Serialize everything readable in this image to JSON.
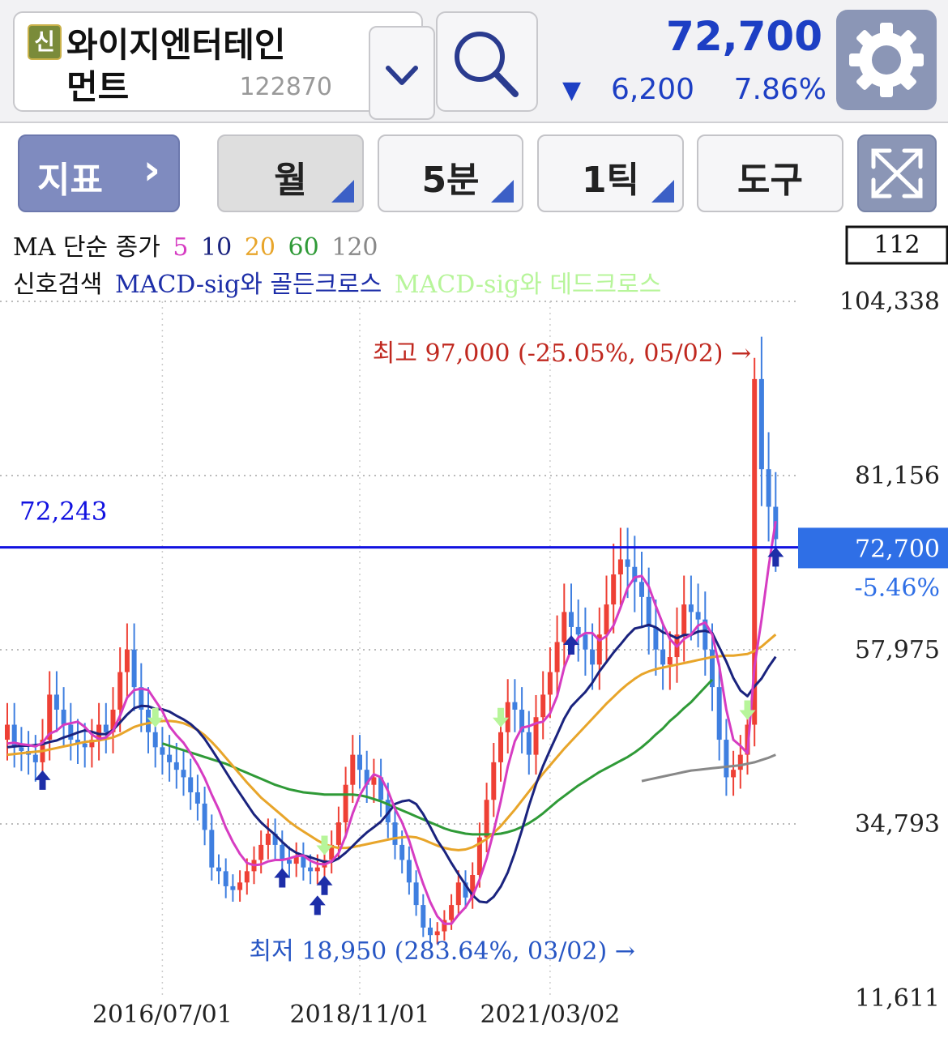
{
  "header": {
    "badge": "신",
    "name_line1": "와이지엔터테인",
    "name_line2": "먼트",
    "code": "122870",
    "price": "72,700",
    "change_arrow": "▼",
    "change_amount": "6,200",
    "change_percent": "7.86%",
    "icons": {
      "dropdown": "chevron-down-icon",
      "search": "search-icon",
      "settings": "gear-icon"
    }
  },
  "toolbar": {
    "indicator": "지표",
    "indicator_arrow": "›",
    "period": "월",
    "minute": "5분",
    "tick": "1틱",
    "tools": "도구",
    "expand_icon": "expand-icon"
  },
  "legend": {
    "ma_prefix": "MA 단순 종가",
    "ma_periods": [
      {
        "label": "5",
        "color": "#d63cc2"
      },
      {
        "label": "10",
        "color": "#1a237e"
      },
      {
        "label": "20",
        "color": "#e8a52a"
      },
      {
        "label": "60",
        "color": "#2f9a37"
      },
      {
        "label": "120",
        "color": "#888888"
      }
    ],
    "signal_prefix": "신호검색",
    "signal_golden": "MACD-sig와 골든크로스",
    "signal_dead": "MACD-sig와 데드크로스",
    "golden_color": "#1d2ea8",
    "dead_color": "#b7f59a"
  },
  "colors": {
    "up": "#ee4035",
    "down": "#3f7fe0",
    "price_line": "#1212e0",
    "current_tag": "#2f6fe6"
  },
  "chart_data": {
    "type": "candlestick",
    "y_ticks": [
      "104,338",
      "81,156",
      "57,975",
      "34,793",
      "11,611"
    ],
    "y_tick_values": [
      104338,
      81156,
      57975,
      34793,
      11611
    ],
    "x_ticks": [
      "2016/07/01",
      "2018/11/01",
      "2021/03/02"
    ],
    "x_tick_index": [
      22,
      50,
      77
    ],
    "count_label": "112",
    "reference_line": {
      "label": "72,243",
      "value": 72243
    },
    "current": {
      "label": "72,700",
      "value": 72700,
      "diff": "-5.46%"
    },
    "high_annotation": {
      "text": "최고 97,000 (-25.05%, 05/02) →",
      "value": 97000,
      "index": 106
    },
    "low_annotation": {
      "text": "최저 18,950 (283.64%, 03/02) →",
      "value": 18950,
      "index": 61
    },
    "close": [
      48000,
      45000,
      44500,
      44000,
      43000,
      46000,
      52000,
      50000,
      48000,
      46000,
      45500,
      45000,
      46000,
      48000,
      47000,
      50000,
      55000,
      58000,
      53000,
      50000,
      47000,
      45000,
      44000,
      43000,
      42000,
      41000,
      39000,
      37500,
      34000,
      29000,
      28500,
      26500,
      26000,
      27000,
      28500,
      30000,
      32000,
      33500,
      32000,
      30000,
      29500,
      30500,
      29000,
      28500,
      29000,
      30000,
      32000,
      35000,
      40000,
      44000,
      42000,
      40000,
      41000,
      38000,
      35000,
      32000,
      30000,
      27000,
      24000,
      21000,
      20000,
      20500,
      22000,
      24000,
      27000,
      25000,
      28000,
      33000,
      38000,
      43000,
      47000,
      51000,
      50000,
      47000,
      44000,
      49000,
      52000,
      55000,
      59000,
      63000,
      61000,
      60000,
      58000,
      56000,
      60000,
      64000,
      68000,
      70000,
      69000,
      67000,
      65000,
      61000,
      58000,
      56000,
      57000,
      60000,
      64000,
      63000,
      62000,
      58000,
      53000,
      46000,
      41000,
      42000,
      44000,
      48000,
      94000,
      82000,
      77000,
      72700
    ],
    "open": [
      46000,
      48000,
      45000,
      44500,
      44000,
      43000,
      46000,
      52000,
      50000,
      48000,
      46000,
      45500,
      45000,
      46000,
      48000,
      47000,
      50000,
      55000,
      58000,
      53000,
      50000,
      47000,
      45000,
      44000,
      43000,
      42000,
      41000,
      39000,
      37500,
      34000,
      29000,
      28500,
      26500,
      26000,
      27000,
      28500,
      30000,
      32000,
      33500,
      32000,
      30000,
      29500,
      30500,
      29000,
      28500,
      29000,
      30000,
      32000,
      35000,
      40000,
      44000,
      42000,
      40000,
      41000,
      38000,
      35000,
      32000,
      30000,
      27000,
      24000,
      21000,
      20000,
      20500,
      22000,
      24000,
      27000,
      25000,
      28000,
      33000,
      38000,
      43000,
      47000,
      51000,
      50000,
      47000,
      44000,
      49000,
      52000,
      55000,
      59000,
      63000,
      61000,
      60000,
      58000,
      56000,
      60000,
      64000,
      68000,
      70000,
      69000,
      67000,
      65000,
      61000,
      58000,
      56000,
      57000,
      60000,
      64000,
      63000,
      62000,
      58000,
      53000,
      46000,
      41000,
      42000,
      44000,
      48000,
      94000,
      82000,
      77000
    ],
    "ma5": [
      45500,
      45600,
      45400,
      45300,
      45100,
      45600,
      46800,
      47200,
      48000,
      48200,
      48400,
      47700,
      46700,
      46100,
      46300,
      47200,
      49200,
      51600,
      52600,
      52800,
      52600,
      51200,
      49800,
      47800,
      46600,
      45600,
      44200,
      42700,
      40900,
      38700,
      36700,
      34300,
      32400,
      30800,
      29600,
      29300,
      29400,
      29800,
      30000,
      30000,
      30200,
      30500,
      30600,
      29900,
      29500,
      29400,
      29800,
      30900,
      33200,
      36200,
      38600,
      40200,
      41400,
      41000,
      39200,
      36800,
      35000,
      32600,
      29600,
      26800,
      24400,
      22500,
      21500,
      21500,
      22700,
      23700,
      25200,
      27400,
      30200,
      33800,
      37800,
      42400,
      45800,
      47600,
      47800,
      48200,
      48400,
      49500,
      51800,
      55600,
      58000,
      59600,
      60200,
      60200,
      59200,
      59800,
      61200,
      63600,
      66200,
      67600,
      67800,
      66400,
      63800,
      61400,
      59400,
      58400,
      59400,
      60000,
      61200,
      61600,
      60000,
      55800,
      50000,
      46000,
      45200,
      44200,
      55800,
      62000,
      69000,
      75100
    ],
    "ma10": [
      45000,
      45100,
      45200,
      45200,
      45300,
      45400,
      45700,
      45900,
      46300,
      46600,
      46950,
      47250,
      47050,
      46750,
      46750,
      47300,
      48300,
      49350,
      50200,
      50500,
      50450,
      50100,
      50050,
      49750,
      49200,
      48700,
      48100,
      47250,
      46100,
      44700,
      43250,
      41750,
      40250,
      38850,
      37450,
      36050,
      35000,
      34150,
      33350,
      32400,
      31550,
      30950,
      30600,
      30350,
      30050,
      29750,
      29750,
      30200,
      30950,
      31850,
      32800,
      33650,
      34350,
      35100,
      36200,
      37450,
      37800,
      37950,
      37450,
      36100,
      34400,
      32600,
      31200,
      29600,
      28100,
      26700,
      25300,
      24450,
      24350,
      25100,
      26450,
      28350,
      30950,
      33950,
      37200,
      40050,
      42500,
      44650,
      46700,
      48800,
      50400,
      51400,
      52350,
      53600,
      55100,
      56350,
      57600,
      58700,
      59850,
      60800,
      61000,
      61300,
      60950,
      60300,
      59950,
      59500,
      59950,
      59950,
      60400,
      60500,
      60200,
      58300,
      56400,
      54200,
      52550,
      51800,
      53100,
      54150,
      55700,
      57050
    ],
    "ma20": [
      44000,
      44100,
      44200,
      44300,
      44400,
      44500,
      44700,
      44900,
      45100,
      45300,
      45500,
      45700,
      45800,
      45900,
      46100,
      46300,
      46700,
      47200,
      47700,
      48000,
      48200,
      48400,
      48500,
      48500,
      48400,
      48200,
      47800,
      47300,
      46600,
      45700,
      44700,
      43600,
      42500,
      41400,
      40300,
      39300,
      38300,
      37500,
      36700,
      35900,
      35100,
      34400,
      33800,
      33200,
      32600,
      32100,
      31800,
      31600,
      31600,
      31700,
      31900,
      32100,
      32300,
      32500,
      32700,
      32900,
      33000,
      33100,
      33000,
      32700,
      32300,
      31900,
      31600,
      31400,
      31300,
      31400,
      31700,
      32200,
      32800,
      33600,
      34500,
      35600,
      36700,
      37900,
      39100,
      40300,
      41500,
      42600,
      43700,
      44800,
      45800,
      46800,
      47800,
      48800,
      49800,
      50800,
      51700,
      52600,
      53400,
      54100,
      54700,
      55100,
      55400,
      55600,
      55800,
      56000,
      56200,
      56400,
      56600,
      56800,
      57000,
      57100,
      57200,
      57200,
      57300,
      57400,
      57800,
      58400,
      59200,
      60000
    ],
    "ma60_start": 22,
    "ma60": [
      45500,
      45200,
      44900,
      44600,
      44300,
      44000,
      43700,
      43400,
      43100,
      42800,
      42400,
      42000,
      41600,
      41200,
      40800,
      40400,
      40000,
      39700,
      39400,
      39200,
      39000,
      38900,
      38800,
      38700,
      38700,
      38700,
      38700,
      38700,
      38600,
      38400,
      38100,
      37800,
      37400,
      37000,
      36600,
      36200,
      35800,
      35400,
      35000,
      34600,
      34200,
      33900,
      33700,
      33500,
      33400,
      33400,
      33400,
      33400,
      33500,
      33700,
      34000,
      34400,
      34900,
      35500,
      36200,
      37000,
      37800,
      38500,
      39200,
      39900,
      40500,
      41100,
      41700,
      42200,
      42700,
      43200,
      43700,
      44300,
      45000,
      45800,
      46700,
      47500,
      48500,
      49300,
      50200,
      51000,
      52000,
      53000,
      54000
    ],
    "ma120_start": 90,
    "ma120": [
      40500,
      40700,
      40900,
      41100,
      41300,
      41500,
      41700,
      41900,
      42000,
      42100,
      42200,
      42300,
      42400,
      42500,
      42600,
      42800,
      43000,
      43300,
      43600,
      44000
    ],
    "golden_cross_index": [
      5,
      39,
      45,
      80,
      116
    ],
    "golden_cross_lower_index": [
      44
    ],
    "dead_cross_index": [
      21,
      45,
      70,
      105
    ]
  }
}
